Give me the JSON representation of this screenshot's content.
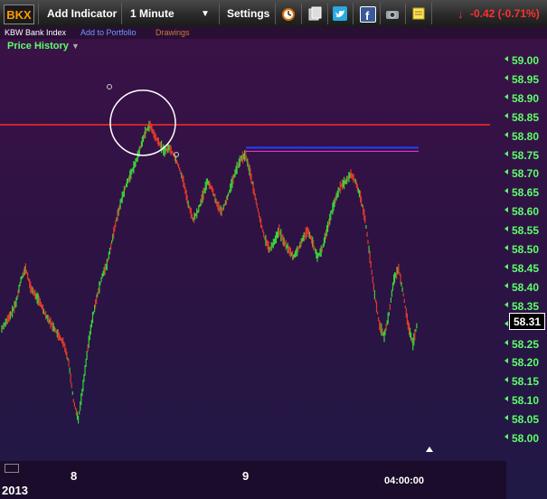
{
  "toolbar": {
    "ticker": "BKX",
    "add_indicator": "Add Indicator",
    "interval": "1 Minute",
    "settings": "Settings",
    "change": "-0.42 (-0.71%)",
    "colors": {
      "ticker": "#ff9a00",
      "change": "#ff3030"
    },
    "icons": [
      "alarm-clock-icon",
      "stack-icon",
      "twitter-icon",
      "facebook-icon",
      "camera-icon",
      "sticky-note-icon"
    ]
  },
  "subbar": {
    "index_name": "KBW Bank Index",
    "add_portfolio": "Add to Portfolio",
    "drawings": "Drawings"
  },
  "panel": {
    "title": "Price History"
  },
  "y_axis": {
    "labels": [
      "59.00",
      "58.95",
      "58.90",
      "58.85",
      "58.80",
      "58.75",
      "58.70",
      "58.65",
      "58.60",
      "58.55",
      "58.50",
      "58.45",
      "58.40",
      "58.35",
      "58.30",
      "58.25",
      "58.20",
      "58.15",
      "58.10",
      "58.05",
      "58.00"
    ],
    "current": "58.31"
  },
  "x_axis": {
    "day_labels": [
      "8",
      "9"
    ],
    "time_label": "04:00:00",
    "year_label": "2013"
  },
  "chart_data": {
    "type": "line",
    "ylim": [
      58.0,
      59.0
    ],
    "series": [
      {
        "values": [
          58.29,
          58.31,
          58.33,
          58.36,
          58.42,
          58.45,
          58.4,
          58.38,
          58.36,
          58.33,
          58.31,
          58.29,
          58.27,
          58.25,
          58.2,
          58.1,
          58.05,
          58.14,
          58.24,
          58.32,
          58.38,
          58.43,
          58.46,
          58.52,
          58.58,
          58.63,
          58.67,
          58.7,
          58.73,
          58.77,
          58.81,
          58.83,
          58.8,
          58.78,
          58.76,
          58.77,
          58.75,
          58.72,
          58.68,
          58.62,
          58.58,
          58.6,
          58.64,
          58.68,
          58.66,
          58.62,
          58.6,
          58.63,
          58.67,
          58.71,
          58.74,
          58.75,
          58.7,
          58.64,
          58.58,
          58.53,
          58.5,
          58.52,
          58.55,
          58.52,
          58.5,
          58.48,
          58.5,
          58.53,
          58.55,
          58.52,
          58.48,
          58.5,
          58.55,
          58.6,
          58.64,
          58.67,
          58.68,
          58.7,
          58.68,
          58.64,
          58.58,
          58.48,
          58.38,
          58.3,
          58.27,
          58.33,
          58.42,
          58.45,
          58.38,
          58.3,
          58.25,
          58.31
        ]
      }
    ],
    "annotations": {
      "red_line": 58.83,
      "blue_line": 58.76,
      "circle_center": 58.84
    }
  }
}
